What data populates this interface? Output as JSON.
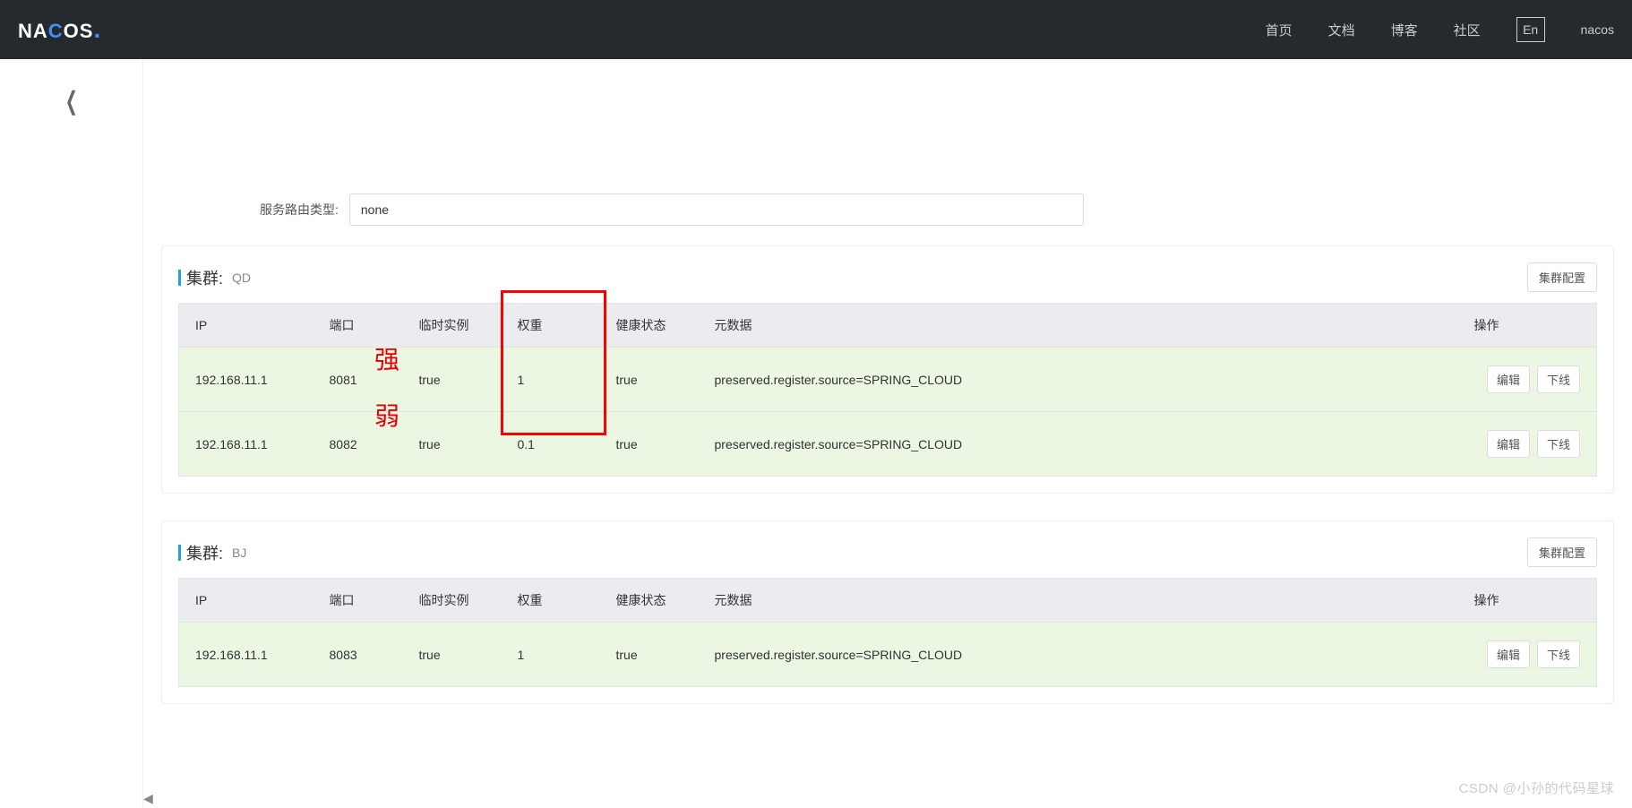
{
  "brand": {
    "n": "N",
    "a": "A",
    "c": "C",
    "o": "O",
    "s": "S",
    "dot": "."
  },
  "nav": {
    "home": "首页",
    "docs": "文档",
    "blog": "博客",
    "community": "社区",
    "lang": "En",
    "user": "nacos"
  },
  "page": {
    "route_type_label": "服务路由类型:",
    "route_type_value": "none"
  },
  "labels": {
    "cluster_prefix": "集群:",
    "cluster_config": "集群配置",
    "edit": "编辑",
    "offline": "下线"
  },
  "columns": {
    "ip": "IP",
    "port": "端口",
    "ephemeral": "临时实例",
    "weight": "权重",
    "health": "健康状态",
    "metadata": "元数据",
    "action": "操作"
  },
  "clusters": [
    {
      "name": "QD",
      "rows": [
        {
          "ip": "192.168.11.1",
          "port": "8081",
          "ephemeral": "true",
          "weight": "1",
          "health": "true",
          "metadata": "preserved.register.source=SPRING_CLOUD"
        },
        {
          "ip": "192.168.11.1",
          "port": "8082",
          "ephemeral": "true",
          "weight": "0.1",
          "health": "true",
          "metadata": "preserved.register.source=SPRING_CLOUD"
        }
      ]
    },
    {
      "name": "BJ",
      "rows": [
        {
          "ip": "192.168.11.1",
          "port": "8083",
          "ephemeral": "true",
          "weight": "1",
          "health": "true",
          "metadata": "preserved.register.source=SPRING_CLOUD"
        }
      ]
    }
  ],
  "annotations": {
    "strong": "强",
    "weak": "弱"
  },
  "watermark": "CSDN @小孙的代码星球"
}
